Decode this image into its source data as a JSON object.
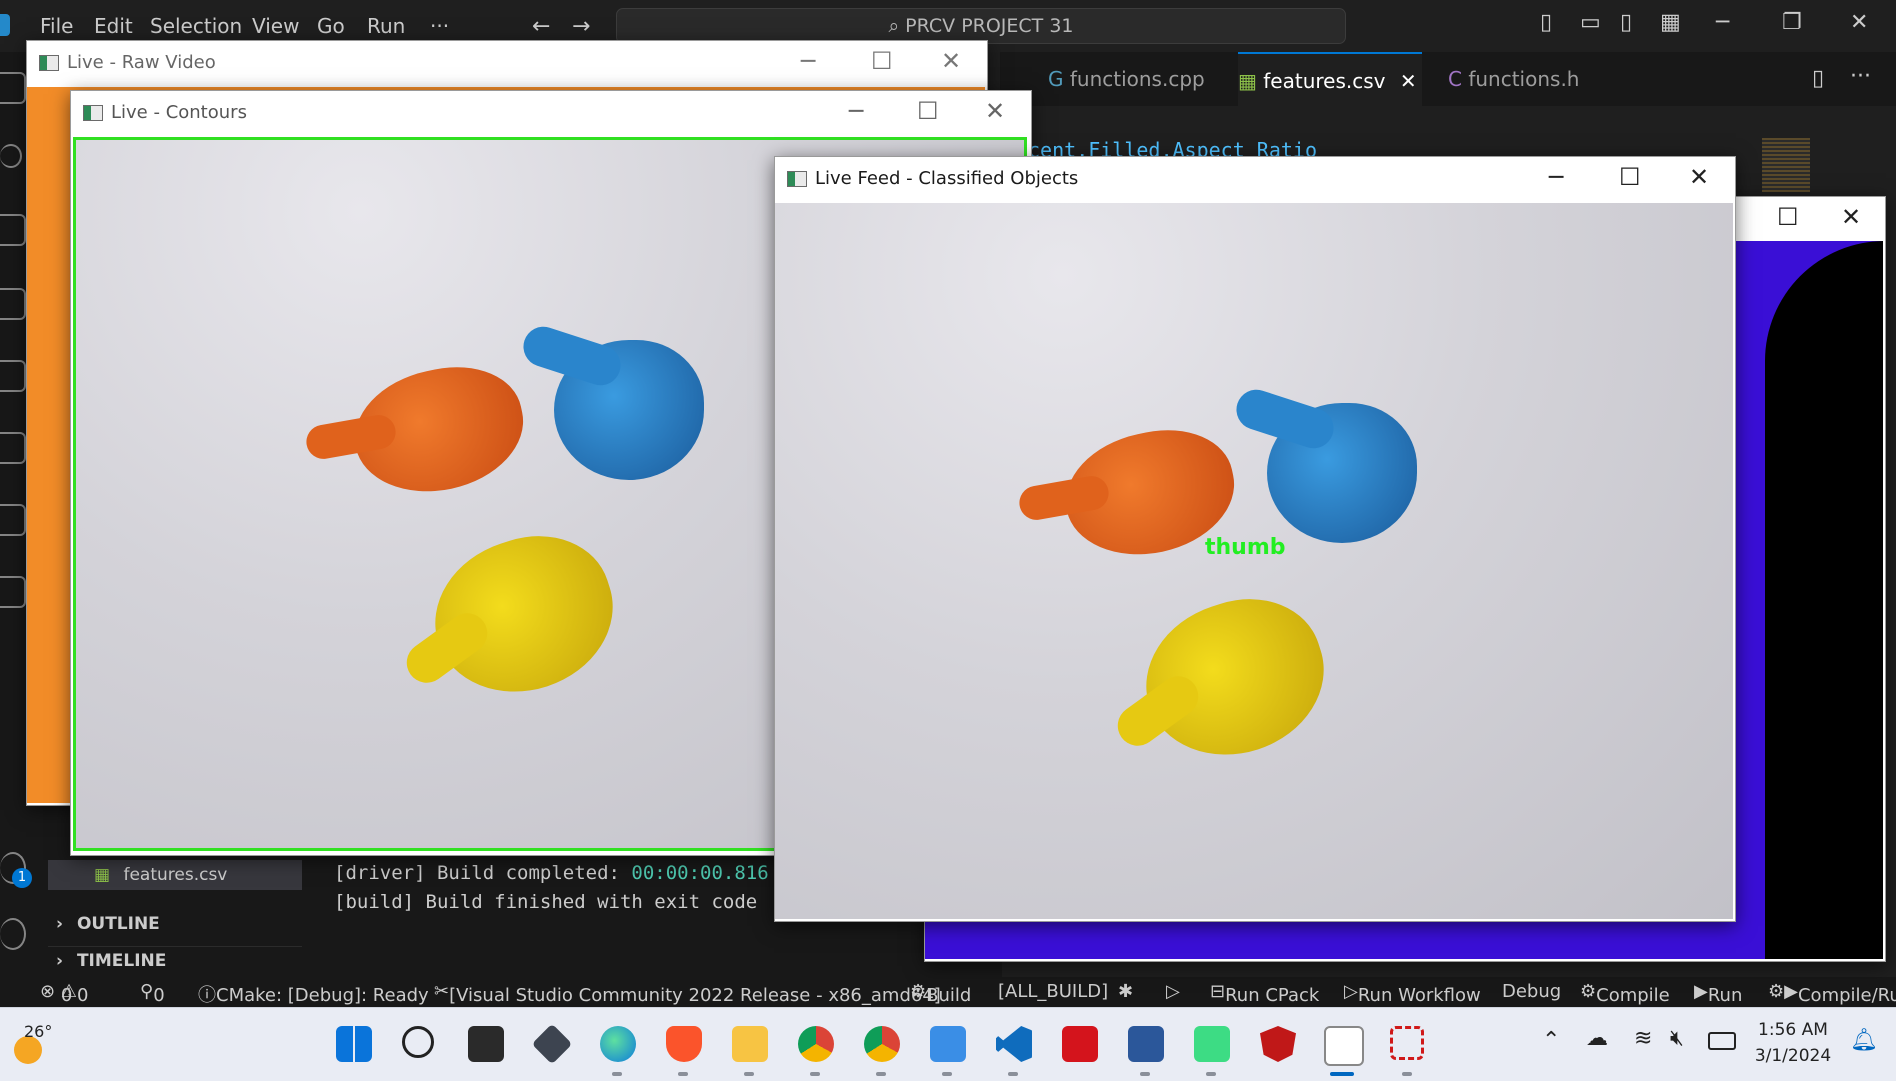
{
  "vscode": {
    "menu": [
      "File",
      "Edit",
      "Selection",
      "View",
      "Go",
      "Run",
      "···"
    ],
    "search_text": "PRCV PROJECT 31",
    "tabs": [
      {
        "label": "functions.cpp",
        "active": false
      },
      {
        "label": "features.csv",
        "active": true
      },
      {
        "label": "functions.h",
        "active": false
      }
    ],
    "code_line": "cent,Filled,Aspect Ratio",
    "sidebar": {
      "file_item": "features.csv",
      "sections": [
        "OUTLINE",
        "TIMELINE"
      ]
    },
    "terminal": [
      {
        "prefix": "[driver] Build completed: ",
        "time": "00:00:00.816"
      },
      {
        "prefix": "[build] Build finished with exit code",
        "time": ""
      }
    ],
    "accounts_badge": "1",
    "statusbar": {
      "errors": "0",
      "warnings": "0",
      "ports": "0",
      "cmake": "CMake: [Debug]: Ready",
      "kit": "[Visual Studio Community 2022 Release - x86_amd64]",
      "build": "Build",
      "target": "[ALL_BUILD]",
      "run_cpack": "Run CPack",
      "run_workflow": "Run Workflow",
      "debug": "Debug",
      "compile": "Compile",
      "run": "Run",
      "compile_run": "Compile/Ru"
    }
  },
  "windows": {
    "raw": {
      "title": "Live - Raw Video"
    },
    "contours": {
      "title": "Live - Contours"
    },
    "classified": {
      "title": "Live Feed - Classified Objects",
      "label": "thumb"
    }
  },
  "taskbar": {
    "weather": "26°",
    "time": "1:56 AM",
    "date": "3/1/2024"
  },
  "colors": {
    "accent": "#0078d4",
    "raw_window": "#f28c28",
    "threshold_window": "#3a0fd6",
    "contour": "#31e022",
    "label": "#22ee22"
  }
}
